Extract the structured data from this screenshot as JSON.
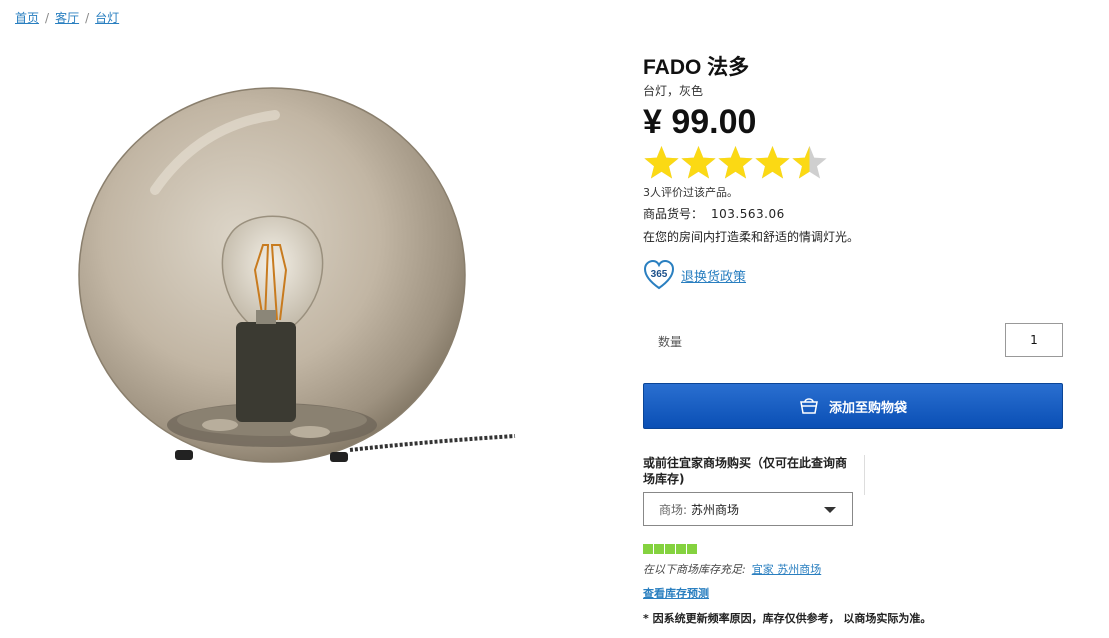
{
  "breadcrumb": {
    "items": [
      "首页",
      "客厅",
      "台灯"
    ],
    "separator": "/"
  },
  "product": {
    "name": "FADO 法多",
    "subtitle": "台灯，灰色",
    "price": "¥ 99.00",
    "rating": 4.5,
    "rating_max": 5,
    "review_count": "3人评价过该产品。",
    "article_label": "商品货号：",
    "article_number": "103.563.06",
    "description": "在您的房间内打造柔和舒适的情调灯光。"
  },
  "returns": {
    "badge": "365",
    "link": "退换货政策"
  },
  "quantity": {
    "label": "数量",
    "value": "1"
  },
  "cart": {
    "add_label": "添加至购物袋"
  },
  "store": {
    "label": "或前往宜家商场购买（仅可在此查询商场库存)",
    "select_prefix": "商场:",
    "select_value": "苏州商场",
    "stock_level": 1.0,
    "stock_text": "在以下商场库存充足:",
    "stock_store_link": "宜家 苏州商场",
    "forecast_link": "查看库存预测",
    "disclaimer": "* 因系统更新频率原因，库存仅供参考， 以商场实际为准。"
  },
  "colors": {
    "link": "#2a7fc0",
    "button": "#0a4fb5",
    "star": "#fbd914",
    "stock": "#84d23f"
  }
}
